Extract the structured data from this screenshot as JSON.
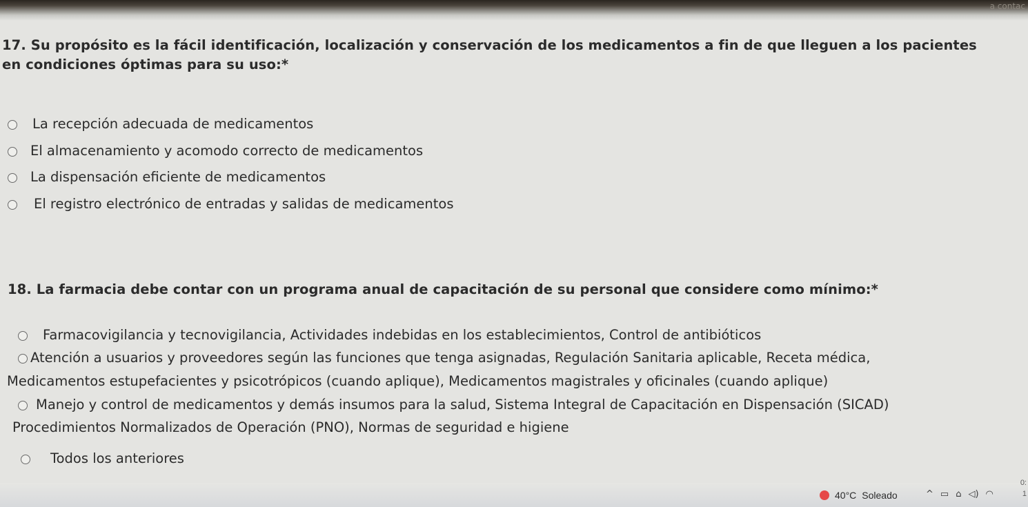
{
  "header": {
    "corner_text": "a contac"
  },
  "questions": [
    {
      "title_line1": "17. Su propósito es la fácil identificación, localización y conservación de los medicamentos a fin de que lleguen a los pacientes",
      "title_line2": "en condiciones óptimas para su uso:*",
      "options": [
        "La recepción adecuada de medicamentos",
        "El almacenamiento y acomodo correcto de medicamentos",
        "La dispensación eficiente de medicamentos",
        "El registro electrónico de entradas y salidas de medicamentos"
      ]
    },
    {
      "title": "18. La farmacia debe contar con un programa anual de capacitación de su personal que considere como mínimo:*",
      "options": [
        "Farmacovigilancia y tecnovigilancia, Actividades indebidas en los establecimientos, Control de antibióticos",
        "Atención a usuarios y proveedores según las funciones que tenga asignadas, Regulación Sanitaria aplicable, Receta médica,",
        "Medicamentos estupefacientes y psicotrópicos (cuando aplique), Medicamentos magistrales y oficinales (cuando aplique)",
        "Manejo y control de medicamentos y demás insumos para la salud, Sistema Integral de Capacitación en Dispensación (SICAD)",
        "Procedimientos Normalizados de Operación (PNO), Normas de seguridad e higiene",
        "Todos los anteriores"
      ]
    }
  ],
  "taskbar": {
    "temperature": "40°C",
    "weather": "Soleado",
    "tray_icons": [
      "chevron-up-icon",
      "battery-icon",
      "network-icon",
      "volume-icon",
      "cloud-icon"
    ],
    "tray_symbols": [
      "^",
      "▭",
      "⌂",
      "◁)",
      "◠"
    ],
    "clock_top": "0:",
    "clock_bottom": "1"
  }
}
